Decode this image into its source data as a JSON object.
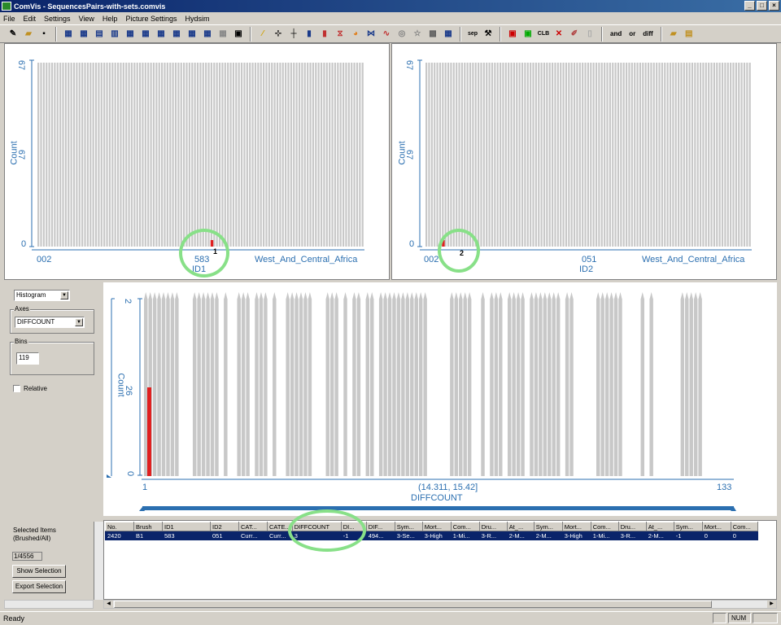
{
  "window": {
    "title": "ComVis - SequencesPairs-with-sets.comvis",
    "minimize": "_",
    "maximize": "□",
    "close": "×"
  },
  "menu": [
    "File",
    "Edit",
    "Settings",
    "View",
    "Help",
    "Picture Settings",
    "Hydsim"
  ],
  "toolbar": {
    "and_label": "and",
    "or_label": "or",
    "diff_label": "diff",
    "clb_label": "CLB",
    "sep_label": "sep"
  },
  "hist1": {
    "ylabel": "Count",
    "ytick_top": "67",
    "ytick_mid": "67",
    "ytick_bottom": "0",
    "x_left": "002",
    "x_mid": "583",
    "x_right": "West_And_Central_Africa",
    "xlabel": "ID1",
    "marker": "1",
    "bins": 119,
    "selected_bin_index": 63
  },
  "hist2": {
    "ylabel": "Count",
    "ytick_top": "67",
    "ytick_mid": "67",
    "ytick_bottom": "0",
    "x_left": "002",
    "x_mid": "051",
    "x_right": "West_And_Central_Africa",
    "xlabel": "ID2",
    "marker": "2",
    "bins": 119,
    "selected_bin_index": 6
  },
  "controls": {
    "view_type": "Histogram",
    "axes_label": "Axes",
    "axes_value": "DIFFCOUNT",
    "bins_label": "Bins",
    "bins_value": "119",
    "relative_label": "Relative"
  },
  "hist3": {
    "ylabel": "Count",
    "ytick_top": "2",
    "ytick_mid": "26",
    "ytick_bottom": "0",
    "x_left": "1",
    "x_mid": "(14.311, 15.42]",
    "x_right": "133",
    "xlabel": "DIFFCOUNT",
    "selected_bin_index": 0,
    "selected_fraction": 0.5
  },
  "selection": {
    "title_line1": "Selected Items",
    "title_line2": "(Brushed/All)",
    "count": "1/4556",
    "show_button": "Show Selection",
    "export_button": "Export Selection"
  },
  "table": {
    "columns": [
      "No.",
      "Brush",
      "ID1",
      "ID2",
      "CAT...",
      "CATE...",
      "DIFFCOUNT",
      "DI...",
      "DIF...",
      "Sym...",
      "Mort...",
      "Com...",
      "Dru...",
      "At_...",
      "Sym...",
      "Mort...",
      "Com...",
      "Dru...",
      "At_...",
      "Sym...",
      "Mort...",
      "Com..."
    ],
    "row": [
      "2420",
      "B1",
      "583",
      "051",
      "Curr...",
      "Curr...",
      "3",
      "-1",
      "494...",
      "3-Se...",
      "3-High",
      "1-Mi...",
      "3-R...",
      "2-M...",
      "2-M...",
      "3-High",
      "1-Mi...",
      "3-R...",
      "2-M...",
      "-1",
      "0",
      "0"
    ]
  },
  "status": {
    "text": "Ready",
    "num": "NUM"
  }
}
